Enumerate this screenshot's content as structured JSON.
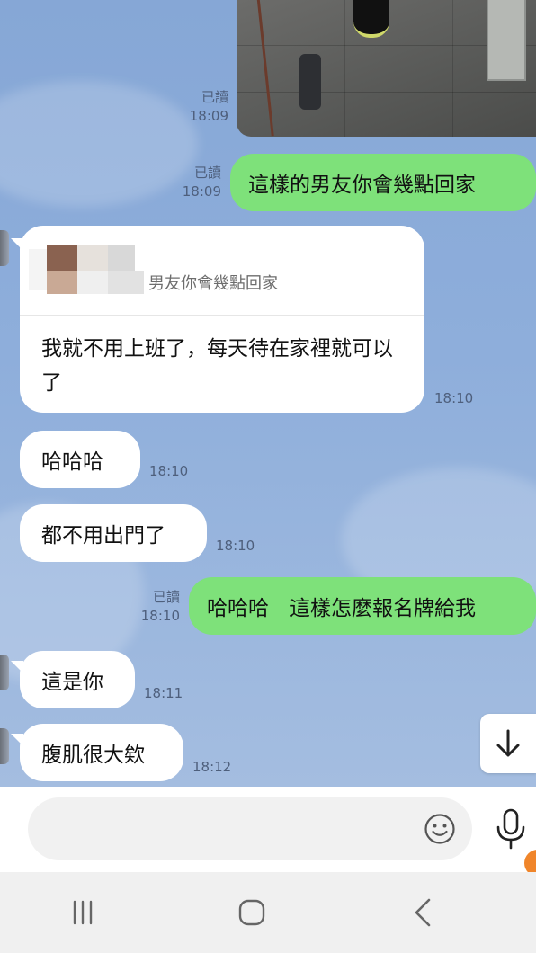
{
  "messages": {
    "photo": {
      "read": "已讀",
      "time": "18:09"
    },
    "out1": {
      "read": "已讀",
      "time": "18:09",
      "text": "這樣的男友你會幾點回家"
    },
    "reply": {
      "quote": "男友你會幾點回家",
      "text": "我就不用上班了，每天待在家裡就可以了",
      "time": "18:10"
    },
    "in2": {
      "text": "哈哈哈",
      "time": "18:10"
    },
    "in3": {
      "text": "都不用出門了",
      "time": "18:10"
    },
    "out2": {
      "read": "已讀",
      "time": "18:10",
      "text": "哈哈哈　這樣怎麼報名牌給我"
    },
    "in4": {
      "text": "這是你",
      "time": "18:11"
    },
    "in5": {
      "text": "腹肌很大欸",
      "time": "18:12"
    }
  },
  "input": {
    "placeholder": "",
    "value": ""
  },
  "icons": {
    "scroll": "arrow-down-icon",
    "emoji": "smiley-icon",
    "mic": "microphone-icon",
    "nav_recent": "recent-apps-icon",
    "nav_home": "home-icon",
    "nav_back": "back-icon"
  },
  "colors": {
    "outgoing_bubble": "#7ee17a",
    "incoming_bubble": "#ffffff",
    "chat_background": "#8eaedb"
  }
}
